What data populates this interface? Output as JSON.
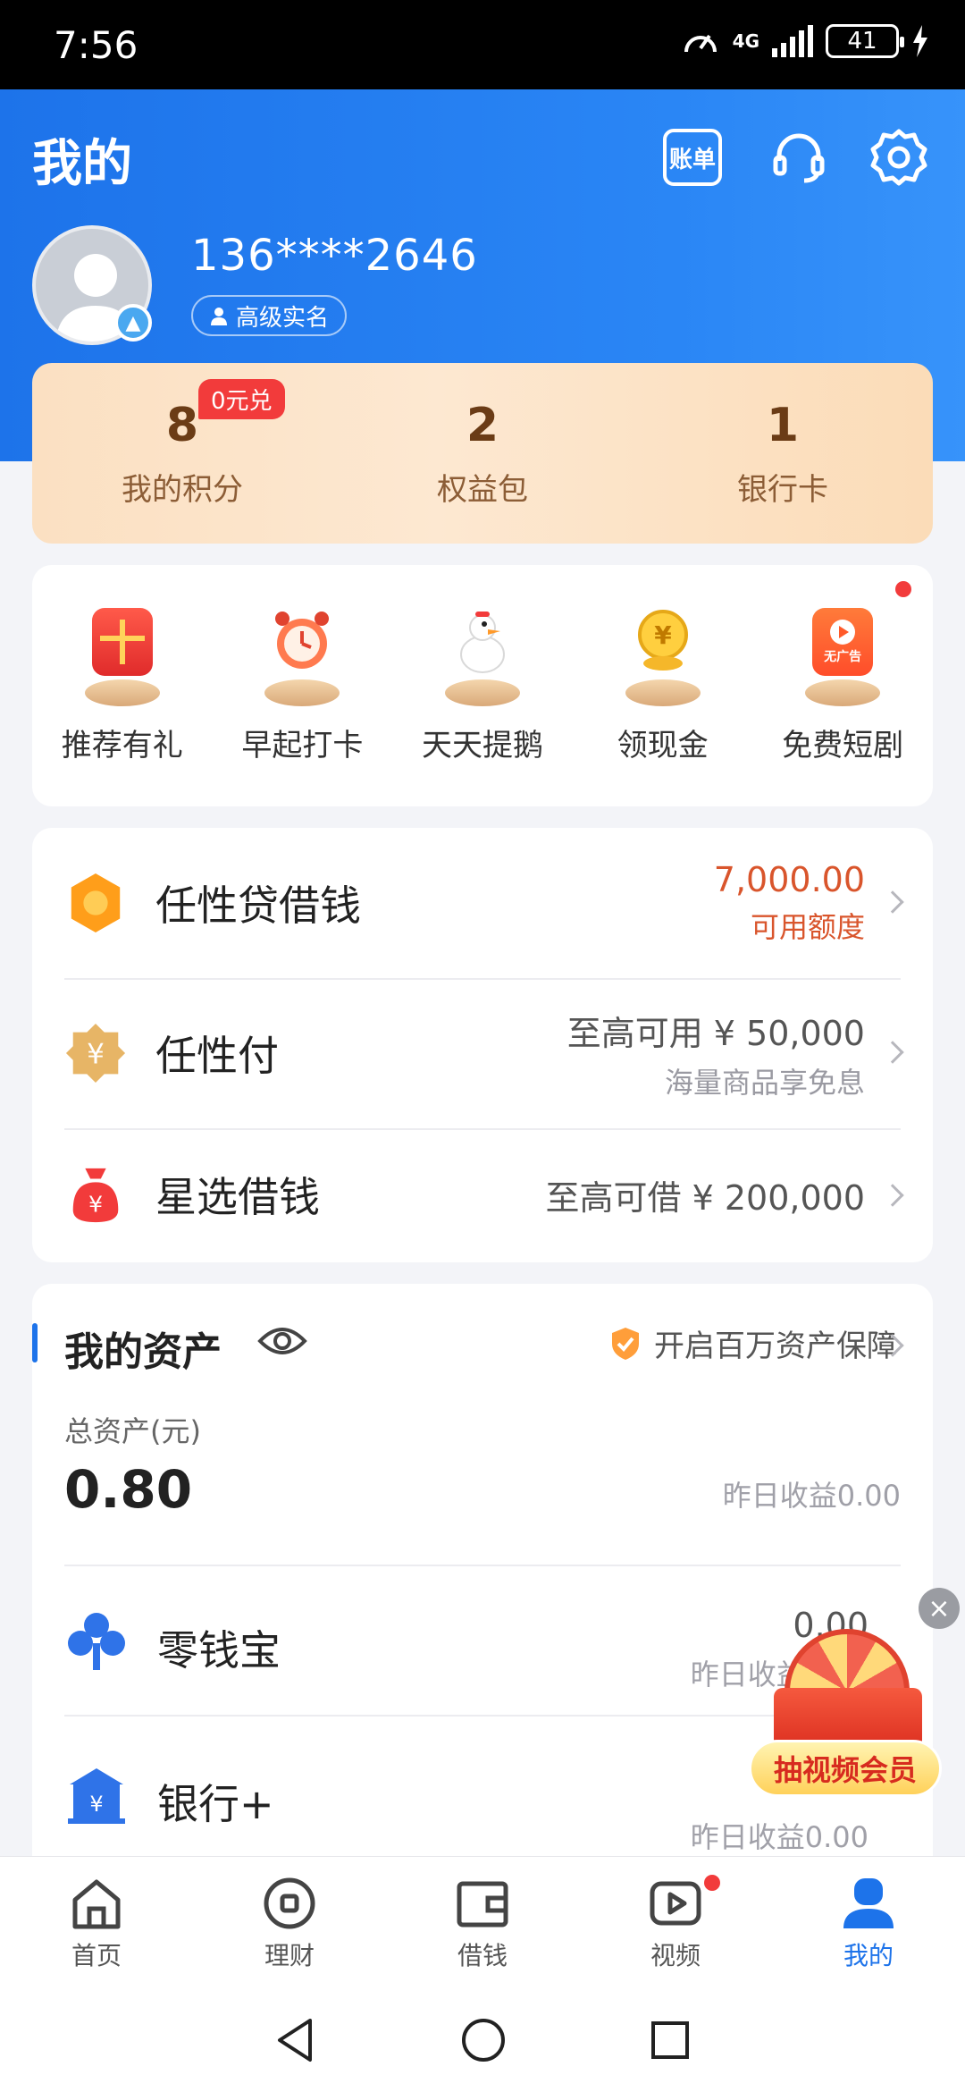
{
  "status": {
    "time": "7:56",
    "network": "4G",
    "battery": "41"
  },
  "header": {
    "title": "我的",
    "bill_label": "账单",
    "phone": "136****2646",
    "verify_label": "高级实名"
  },
  "points": {
    "badge": "0元兑",
    "items": [
      {
        "value": "8",
        "label": "我的积分"
      },
      {
        "value": "2",
        "label": "权益包"
      },
      {
        "value": "1",
        "label": "银行卡"
      }
    ]
  },
  "shortcuts": [
    {
      "label": "推荐有礼",
      "icon": "gift-icon"
    },
    {
      "label": "早起打卡",
      "icon": "alarm-clock-icon"
    },
    {
      "label": "天天提鹅",
      "icon": "goose-icon"
    },
    {
      "label": "领现金",
      "icon": "coin-icon"
    },
    {
      "label": "免费短剧",
      "icon": "video-play-icon",
      "tag": "无广告"
    }
  ],
  "loans": [
    {
      "title": "任性贷借钱",
      "amount": "7,000.00",
      "sub": "可用额度"
    },
    {
      "title": "任性付",
      "amount": "至高可用 ¥ 50,000",
      "sub": "海量商品享免息"
    },
    {
      "title": "星选借钱",
      "amount": "至高可借 ¥ 200,000"
    }
  ],
  "assets": {
    "title": "我的资产",
    "protect_label": "开启百万资产保障",
    "total_label": "总资产(元)",
    "total_value": "0.80",
    "yesterday": "昨日收益0.00",
    "items": [
      {
        "title": "零钱宝",
        "value": "0.00",
        "sub": "昨日收益0.00"
      },
      {
        "title": "银行+",
        "value": "",
        "sub": "昨日收益0.00"
      }
    ]
  },
  "promo": {
    "label": "抽视频会员"
  },
  "nav": [
    {
      "label": "首页",
      "icon": "home-icon"
    },
    {
      "label": "理财",
      "icon": "finance-icon"
    },
    {
      "label": "借钱",
      "icon": "wallet-icon"
    },
    {
      "label": "视频",
      "icon": "video-icon"
    },
    {
      "label": "我的",
      "icon": "profile-icon"
    }
  ],
  "colors": {
    "brand": "#1d73ea",
    "accent_red": "#f23b3b",
    "amount_red": "#d9552c"
  }
}
